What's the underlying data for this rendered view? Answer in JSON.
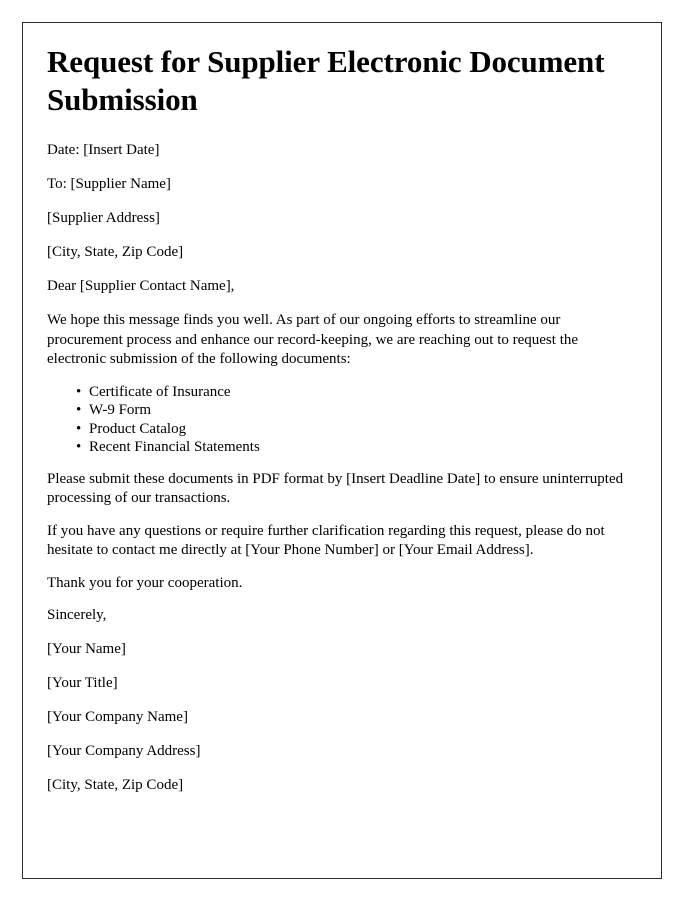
{
  "document": {
    "title": "Request for Supplier Electronic Document Submission",
    "meta": {
      "date_line": "Date: [Insert Date]",
      "to_line": "To: [Supplier Name]",
      "address_line": "[Supplier Address]",
      "city_state_zip_line": "[City, State, Zip Code]",
      "salutation": "Dear [Supplier Contact Name],"
    },
    "intro_paragraph": "We hope this message finds you well. As part of our ongoing efforts to streamline our procurement process and enhance our record-keeping, we are reaching out to request the electronic submission of the following documents:",
    "requested_documents": [
      "Certificate of Insurance",
      "W-9 Form",
      "Product Catalog",
      "Recent Financial Statements"
    ],
    "bullet_glyph": "•",
    "deadline_paragraph": "Please submit these documents in PDF format by [Insert Deadline Date] to ensure uninterrupted processing of our transactions.",
    "contact_paragraph": "If you have any questions or require further clarification regarding this request, please do not hesitate to contact me directly at [Your Phone Number] or [Your Email Address].",
    "thanks_paragraph": "Thank you for your cooperation.",
    "closing": "Sincerely,",
    "signature": {
      "name": "[Your Name]",
      "title": "[Your Title]",
      "company_name": "[Your Company Name]",
      "company_address": "[Your Company Address]",
      "city_state_zip": "[City, State, Zip Code]"
    }
  }
}
